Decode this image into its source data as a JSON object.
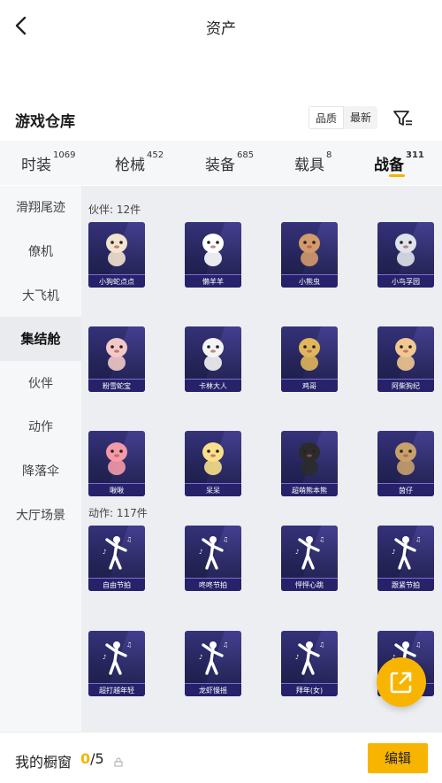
{
  "header": {
    "title": "资产"
  },
  "section": {
    "title": "游戏仓库",
    "sort_options": [
      "品质",
      "最新"
    ]
  },
  "tabs": [
    {
      "label": "时装",
      "count": "1069",
      "active": false
    },
    {
      "label": "枪械",
      "count": "452",
      "active": false
    },
    {
      "label": "装备",
      "count": "685",
      "active": false
    },
    {
      "label": "载具",
      "count": "8",
      "active": false
    },
    {
      "label": "战备",
      "count": "311",
      "active": true
    }
  ],
  "sidebar": {
    "items": [
      {
        "label": "滑翔尾迹",
        "active": false
      },
      {
        "label": "僚机",
        "active": false
      },
      {
        "label": "大飞机",
        "active": false
      },
      {
        "label": "集结舱",
        "active": true
      },
      {
        "label": "伙伴",
        "active": false
      },
      {
        "label": "动作",
        "active": false
      },
      {
        "label": "降落伞",
        "active": false
      },
      {
        "label": "大厅场景",
        "active": false
      }
    ]
  },
  "groups": {
    "partners": {
      "label": "伙伴: 12件",
      "items": [
        "小狗蛇点点",
        "懒羊羊",
        "小熊虫",
        "小鸟孚园",
        "粉雪蛇宝",
        "卡林大人",
        "鸡哥",
        "阿柴狗纪",
        "啾啾",
        "呆呆",
        "超萌熊本熊",
        "茵仔"
      ]
    },
    "emotes": {
      "label": "动作: 117件",
      "items": [
        "自由节拍",
        "咚咚节拍",
        "怦怦心跳",
        "跟紧节拍",
        "超打越年轻",
        "龙虾慢摇",
        "拜年(女)",
        ""
      ]
    }
  },
  "bottom": {
    "showcase_label": "我的橱窗",
    "current": "0",
    "total": "/5",
    "edit_label": "编辑"
  },
  "colors": {
    "accent": "#f7b502",
    "card": "#2a2868"
  }
}
